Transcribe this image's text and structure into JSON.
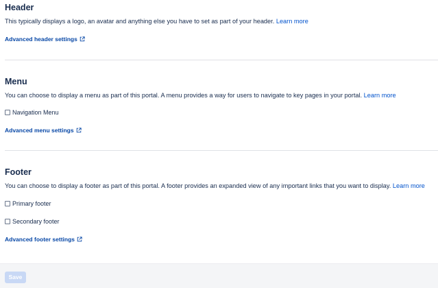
{
  "header_section": {
    "title": "Header",
    "description": "This typically displays a logo, an avatar and anything else you have to set as part of your header.",
    "learn_more": "Learn more",
    "advanced_link": "Advanced header settings"
  },
  "menu_section": {
    "title": "Menu",
    "description": "You can choose to display a menu as part of this portal. A menu provides a way for users to navigate to key pages in your portal.",
    "learn_more": "Learn more",
    "options": [
      {
        "label": "Navigation Menu",
        "checked": false
      }
    ],
    "advanced_link": "Advanced menu settings"
  },
  "footer_section": {
    "title": "Footer",
    "description": "You can choose to display a footer as part of this portal. A footer provides an expanded view of any important links that you want to display.",
    "learn_more": "Learn more",
    "options": [
      {
        "label": "Primary footer",
        "checked": false
      },
      {
        "label": "Secondary footer",
        "checked": false
      }
    ],
    "advanced_link": "Advanced footer settings"
  },
  "actions": {
    "save_label": "Save"
  },
  "colors": {
    "link": "#0052cc",
    "text": "#172b4d",
    "save_disabled": "#c8d8f5"
  }
}
